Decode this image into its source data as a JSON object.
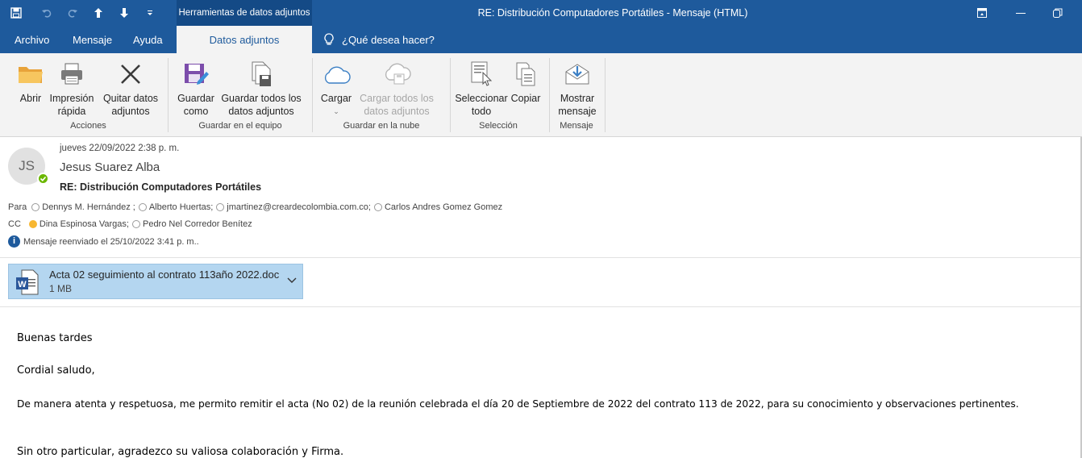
{
  "titlebar": {
    "context_tab": "Herramientas de datos adjuntos",
    "window_title": "RE: Distribución Computadores Portátiles  -  Mensaje (HTML)"
  },
  "tabs": {
    "archivo": "Archivo",
    "mensaje": "Mensaje",
    "ayuda": "Ayuda",
    "datos_adjuntos": "Datos adjuntos",
    "tell_me": "¿Qué desea hacer?"
  },
  "ribbon": {
    "abrir": "Abrir",
    "impresion_l1": "Impresión",
    "impresion_l2": "rápida",
    "quitar_l1": "Quitar datos",
    "quitar_l2": "adjuntos",
    "guardar_como_l1": "Guardar",
    "guardar_como_l2": "como",
    "guardar_todos_l1": "Guardar todos los",
    "guardar_todos_l2": "datos adjuntos",
    "cargar": "Cargar",
    "cargar_todos_l1": "Cargar todos los",
    "cargar_todos_l2": "datos adjuntos",
    "seleccionar_l1": "Seleccionar",
    "seleccionar_l2": "todo",
    "copiar": "Copiar",
    "mostrar_l1": "Mostrar",
    "mostrar_l2": "mensaje",
    "groups": {
      "acciones": "Acciones",
      "guardar_equipo": "Guardar en el equipo",
      "guardar_nube": "Guardar en la nube",
      "seleccion": "Selección",
      "mensaje": "Mensaje"
    }
  },
  "header": {
    "initials": "JS",
    "date": "jueves 22/09/2022 2:38 p. m.",
    "from": "Jesus Suarez Alba",
    "subject": "RE: Distribución Computadores Portátiles",
    "to_label": "Para",
    "to": [
      "Dennys M. Hernández ;",
      "Alberto Huertas;",
      "jmartinez@creardecolombia.com.co;",
      "Carlos Andres Gomez Gomez"
    ],
    "cc_label": "CC",
    "cc": [
      "Dina Espinosa Vargas;",
      "Pedro Nel Corredor Benítez"
    ],
    "info": "Mensaje reenviado el 25/10/2022 3:41 p. m.."
  },
  "attachment": {
    "name": "Acta 02 seguimiento al contrato 113año 2022.doc",
    "size": "1 MB"
  },
  "body": {
    "greeting": "Buenas tardes",
    "salute": "Cordial saludo,",
    "paragraph": " De manera atenta y respetuosa,  me permito remitir el acta (No 02) de la reunión celebrada el día 20 de Septiembre de 2022 del contrato 113 de 2022, para su conocimiento y observaciones pertinentes.",
    "closing": "Sin otro particular, agradezco su valiosa colaboración y Firma."
  },
  "colors": {
    "titlebar": "#1e5a9c",
    "context_tab": "#144a86",
    "ribbon": "#f3f3f3",
    "attachment": "#b4d6f0"
  }
}
